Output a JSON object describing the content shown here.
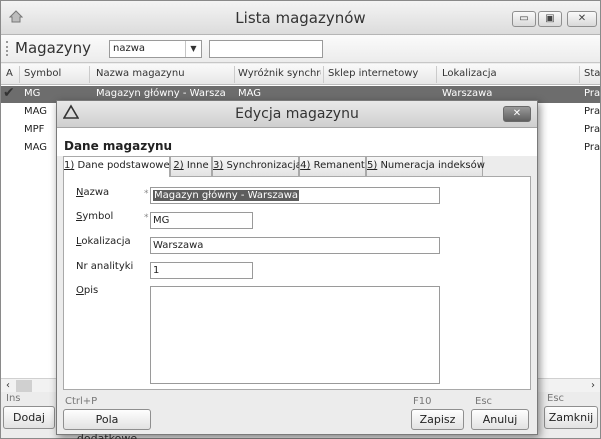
{
  "window": {
    "title": "Lista magazynów",
    "controls": {
      "minimize": "▭",
      "maximize": "▣",
      "close": "✕"
    }
  },
  "toolbar": {
    "title": "Magazyny",
    "search_field": {
      "selected": "nazwa"
    },
    "search_value": ""
  },
  "grid": {
    "columns": [
      "A",
      "Symbol",
      "Nazwa magazynu",
      "Wyróżnik synchro.",
      "Sklep internetowy",
      "Lokalizacja",
      "Sta"
    ],
    "rows": [
      {
        "active": true,
        "symbol": "MG",
        "name": "Magazyn główny - Warsza",
        "sync": "MAG",
        "shop": "",
        "location": "Warszawa",
        "status": "Prac"
      },
      {
        "active": false,
        "symbol": "MAG",
        "name": "",
        "sync": "",
        "shop": "",
        "location": "",
        "status": "Prac"
      },
      {
        "active": false,
        "symbol": "MPF",
        "name": "",
        "sync": "",
        "shop": "",
        "location": "",
        "status": "Prac"
      },
      {
        "active": false,
        "symbol": "MAG",
        "name": "",
        "sync": "",
        "shop": "",
        "location": "",
        "status": "Prac"
      }
    ],
    "scroll_left": "‹",
    "scroll_right": "›"
  },
  "bottombar": {
    "hint_left": "Ins",
    "add_button": "Dodaj",
    "hint_right": "Esc",
    "close_button": "Zamknij"
  },
  "dialog": {
    "title": "Edycja magazynu",
    "close": "✕",
    "header": "Dane magazynu",
    "tabs": [
      {
        "key": "1)",
        "label": " Dane podstawowe"
      },
      {
        "key": "2)",
        "label": " Inne"
      },
      {
        "key": "3)",
        "label": " Synchronizacja"
      },
      {
        "key": "4)",
        "label": " Remanent"
      },
      {
        "key": "5)",
        "label": " Numeracja indeksów"
      }
    ],
    "fields": {
      "name_label_key": "N",
      "name_label_rest": "azwa",
      "name_value": "Magazyn główny - Warszawa",
      "symbol_label_key": "S",
      "symbol_label_rest": "ymbol",
      "symbol_value": "MG",
      "location_label_key": "L",
      "location_label_rest": "okalizacja",
      "location_value": "Warszawa",
      "analytics_label": "Nr analityki",
      "analytics_value": "1",
      "desc_label_key": "O",
      "desc_label_rest": "pis",
      "required_mark": "*"
    },
    "footer": {
      "extra_hint": "Ctrl+P",
      "extra_button": "Pola dodatkowe",
      "save_hint": "F10",
      "save_button": "Zapisz",
      "cancel_hint": "Esc",
      "cancel_button": "Anuluj"
    }
  }
}
